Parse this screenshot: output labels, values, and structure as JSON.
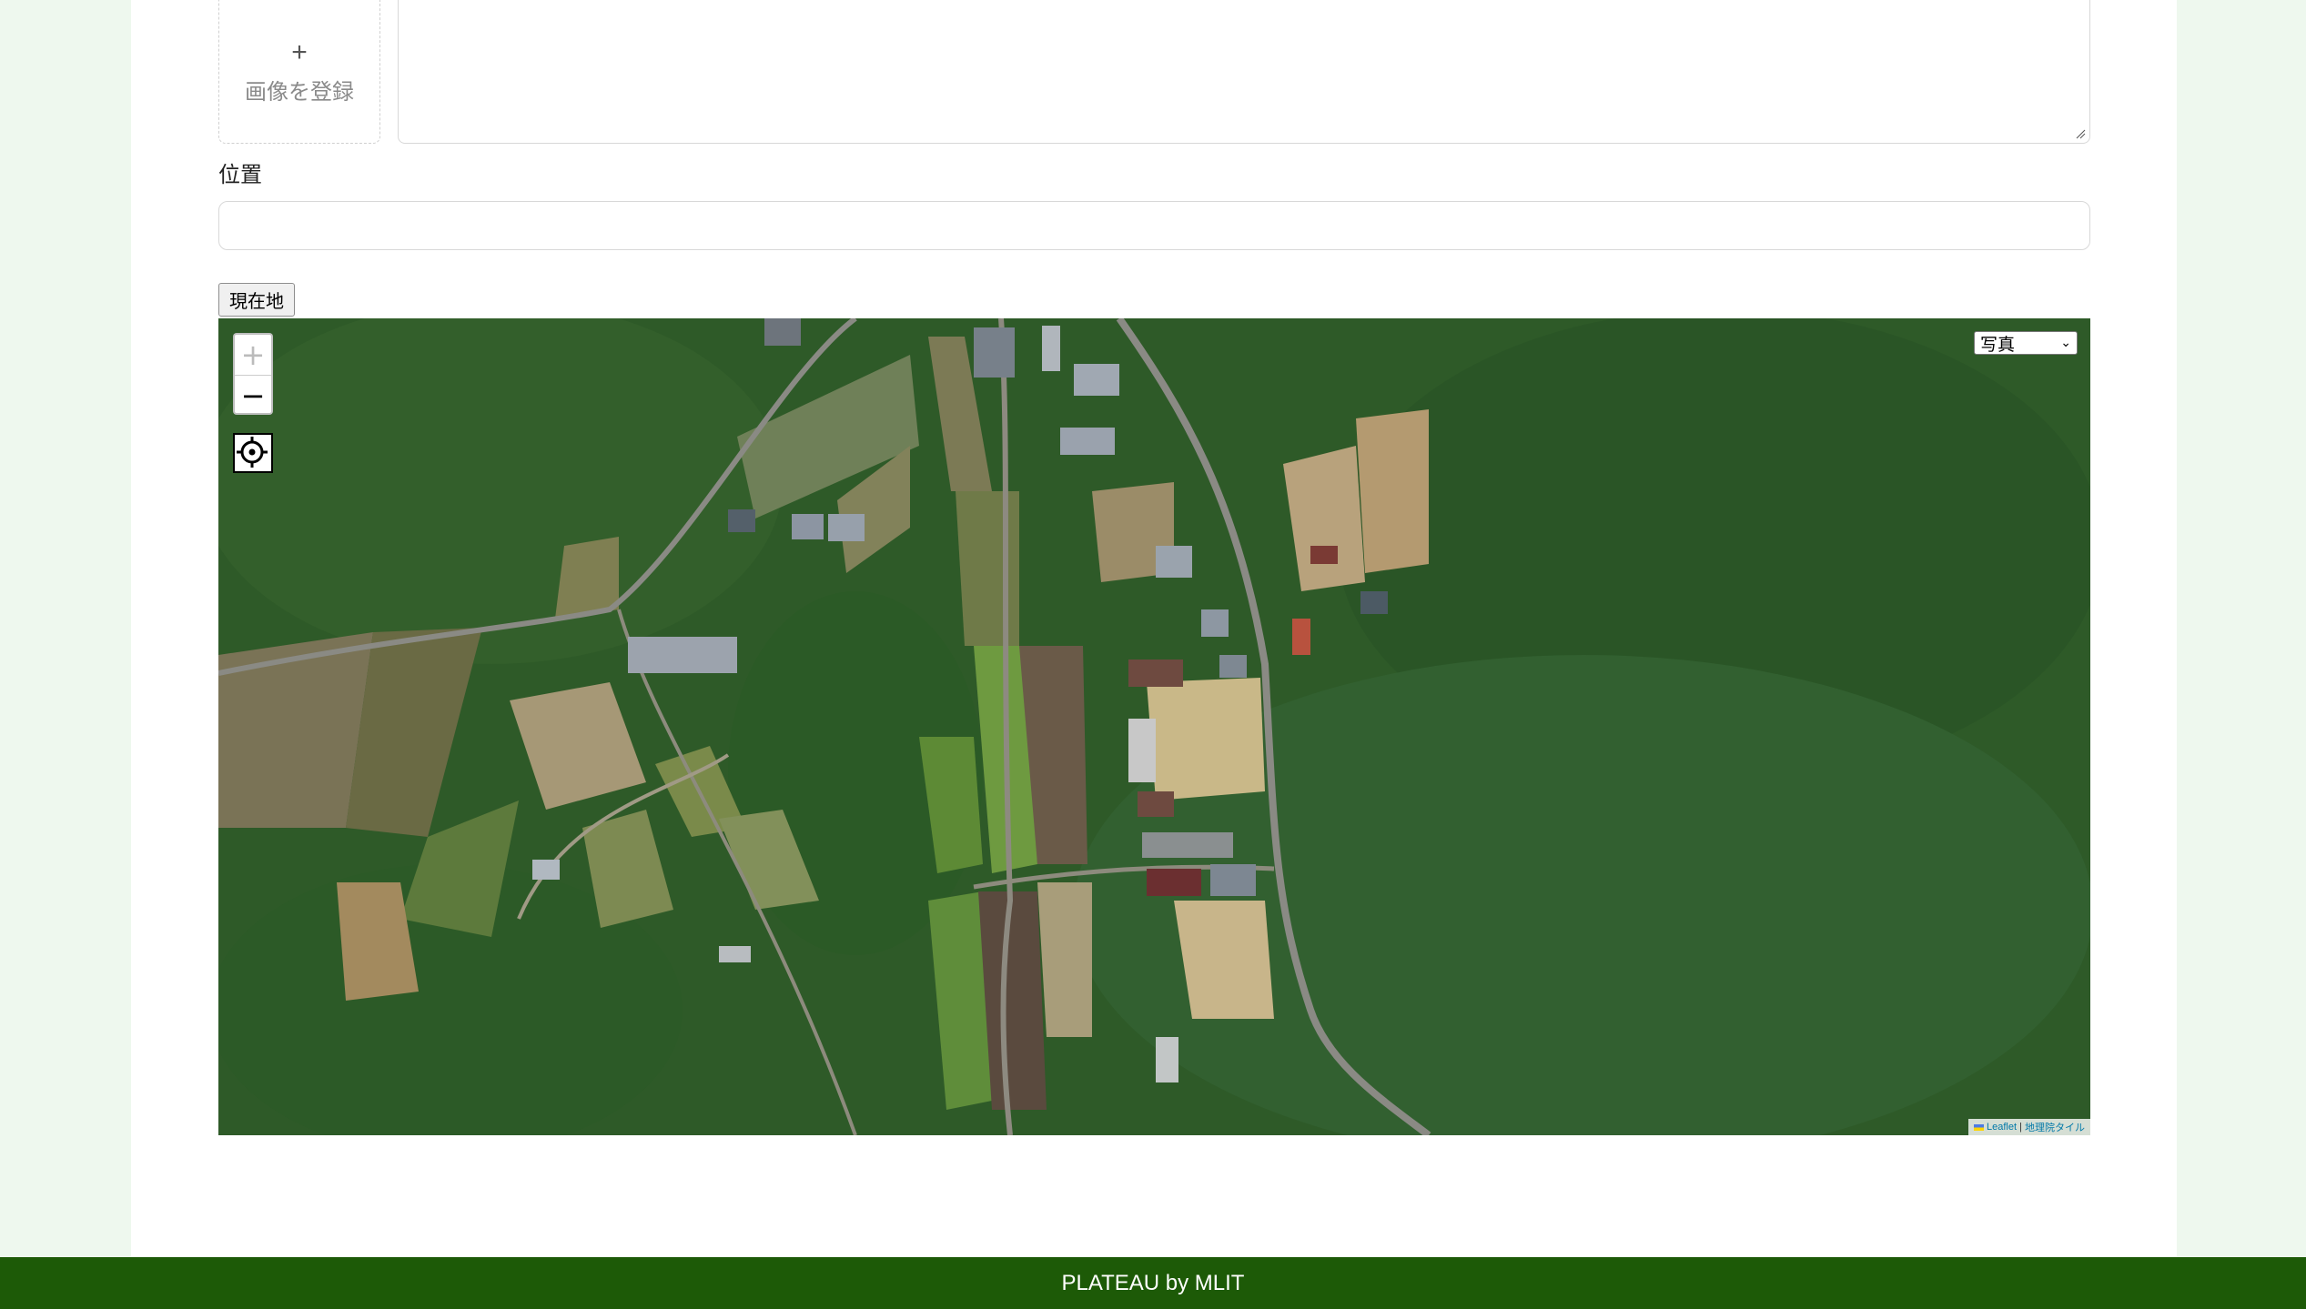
{
  "upload": {
    "plus": "+",
    "label": "画像を登録"
  },
  "position": {
    "label": "位置",
    "value": ""
  },
  "current_location_button": "現在地",
  "map": {
    "zoom_in": "+",
    "zoom_out": "−",
    "layer_selected": "写真",
    "attribution_leaflet": "Leaflet",
    "attribution_sep": " | ",
    "attribution_tiles": "地理院タイル"
  },
  "footer": {
    "text": "PLATEAU by MLIT"
  },
  "colors": {
    "footer_bg": "#1d5a07",
    "page_bg": "#eef8ee",
    "forest": "#2f5a2a"
  }
}
